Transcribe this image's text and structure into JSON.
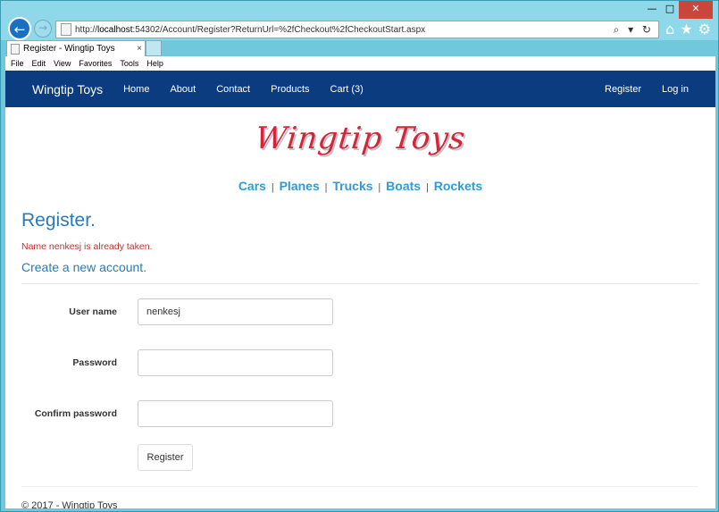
{
  "browser": {
    "url_prefix": "http://",
    "url_host": "localhost",
    "url_rest": ":54302/Account/Register?ReturnUrl=%2fCheckout%2fCheckoutStart.aspx",
    "tab_title": "Register - Wingtip Toys",
    "menu": [
      "File",
      "Edit",
      "View",
      "Favorites",
      "Tools",
      "Help"
    ],
    "window_buttons": {
      "minimize": "—",
      "maximize": "□",
      "close": "✕"
    },
    "addr_tools": "⌕ ▾ ↻",
    "tab_close": "×"
  },
  "navbar": {
    "brand": "Wingtip Toys",
    "links": [
      "Home",
      "About",
      "Contact",
      "Products",
      "Cart (3)"
    ],
    "right_links": [
      "Register",
      "Log in"
    ]
  },
  "logo": "Wingtip Toys",
  "categories": [
    "Cars",
    "Planes",
    "Trucks",
    "Boats",
    "Rockets"
  ],
  "separator": "|",
  "page": {
    "title": "Register.",
    "error": "Name nenkesj is already taken.",
    "subtitle": "Create a new account."
  },
  "form": {
    "username_label": "User name",
    "username_value": "nenkesj",
    "password_label": "Password",
    "confirm_label": "Confirm password",
    "submit_label": "Register"
  },
  "footer": "© 2017 - Wingtip Toys",
  "colors": {
    "navbar": "#0b3c80",
    "heading": "#2a7ab8",
    "error": "#c0302a",
    "category_link": "#2e9bd8",
    "logo": "#d3243a"
  }
}
